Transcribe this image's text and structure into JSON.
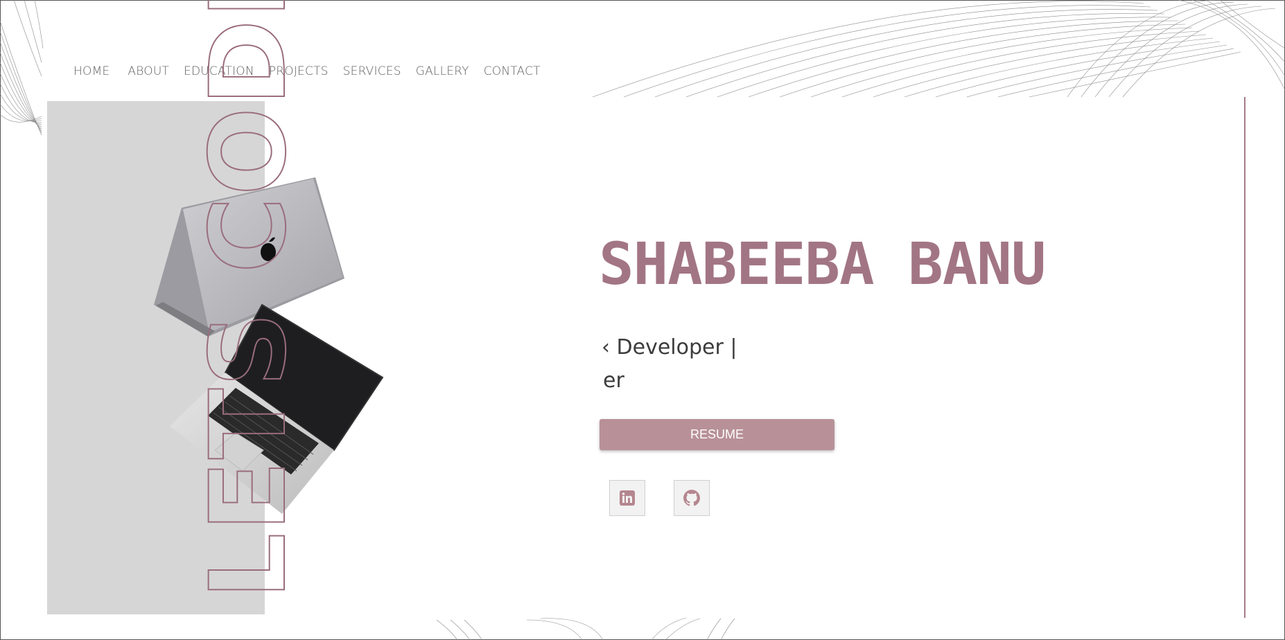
{
  "nav": {
    "items": [
      "HOME",
      "ABOUT",
      "EDUCATION",
      "PROJECTS",
      "SERVICES",
      "GALLERY",
      "CONTACT"
    ]
  },
  "hero": {
    "vertical_text": "LETS CODE",
    "name": "SHABEEBA BANU",
    "typed_line1": "‹ Developer |",
    "typed_line2": "er",
    "resume_label": "RESUME"
  },
  "social": [
    {
      "icon": "linkedin-icon"
    },
    {
      "icon": "github-icon"
    }
  ],
  "colors": {
    "accent": "#a27585",
    "button": "#b89198",
    "panel": "#d6d6d6",
    "nav_text": "#5f5f5f",
    "body_text": "#3c3c3c"
  }
}
